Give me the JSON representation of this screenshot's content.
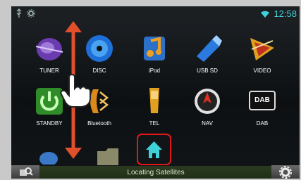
{
  "status_bar": {
    "time": "12:58",
    "left_icons": [
      "usb-icon",
      "settings-icon"
    ],
    "right_icon": "wifi-icon"
  },
  "apps": [
    {
      "label": "TUNER",
      "icon": "tuner-icon"
    },
    {
      "label": "DISC",
      "icon": "disc-icon"
    },
    {
      "label": "iPod",
      "icon": "ipod-icon"
    },
    {
      "label": "USB SD",
      "icon": "usb-sd-icon"
    },
    {
      "label": "VIDEO",
      "icon": "video-icon"
    },
    {
      "label": "STANDBY",
      "icon": "power-icon"
    },
    {
      "label": "Bluetooth",
      "icon": "bluetooth-icon"
    },
    {
      "label": "TEL",
      "icon": "phone-icon"
    },
    {
      "label": "NAV",
      "icon": "nav-icon"
    },
    {
      "label": "DAB",
      "icon": "dab-icon"
    }
  ],
  "dab_icon_text": "DAB",
  "bottom_bar": {
    "status": "Locating Satellites",
    "left_button_icon": "search-icon",
    "right_button_icon": "gear-icon"
  },
  "overlay": {
    "gesture": "vertical-scroll",
    "hand_icon": "hand-pointer-icon",
    "arrow_color": "#e0502a",
    "home_highlight_color": "#e01818"
  }
}
